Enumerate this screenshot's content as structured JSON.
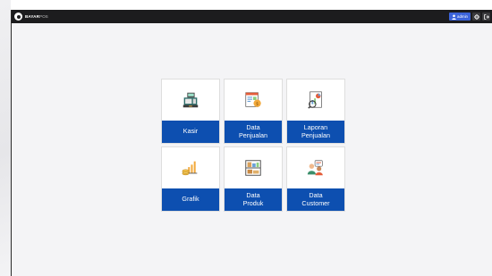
{
  "brand": {
    "name": "BAYAR",
    "suffix": "POS"
  },
  "topbar": {
    "user_label": "admin",
    "user_icon": "user-icon",
    "settings_icon": "gear-icon",
    "logout_icon": "logout-icon"
  },
  "menu": {
    "tiles": [
      {
        "label": "Kasir",
        "icon": "cash-register-icon"
      },
      {
        "label": "Data\nPenjualan",
        "icon": "sales-report-icon"
      },
      {
        "label": "Laporan\nPenjualan",
        "icon": "sales-analytics-icon"
      },
      {
        "label": "Grafik",
        "icon": "bar-chart-coins-icon"
      },
      {
        "label": "Data\nProduk",
        "icon": "product-boxes-icon"
      },
      {
        "label": "Data\nCustomer",
        "icon": "customers-icon"
      }
    ]
  },
  "colors": {
    "topbar": "#1c1c1e",
    "accent": "#3b63d9",
    "tile_label_bg": "#0d4fb0",
    "background": "#f4f4f6"
  }
}
